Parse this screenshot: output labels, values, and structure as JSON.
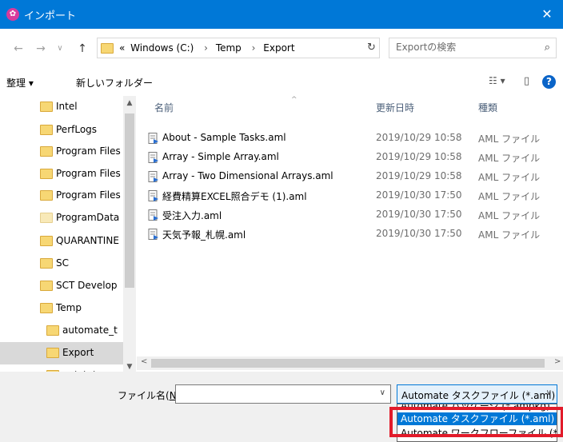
{
  "window": {
    "title": "インポート",
    "close_glyph": "✕"
  },
  "nav_buttons": {
    "back": "←",
    "forward": "→",
    "history": "∨",
    "up": "↑"
  },
  "address": {
    "crumbs": [
      "«",
      "Windows (C:)",
      "›",
      "Temp",
      "›",
      "Export"
    ],
    "dropdown": "∨",
    "refresh": "↻"
  },
  "search": {
    "placeholder": "Exportの検索",
    "icon": "⌕"
  },
  "toolbar": {
    "organize_label": "整理 ▾",
    "new_folder_label": "新しいフォルダー",
    "view_glyph": "☷ ▾",
    "preview_glyph": "▯",
    "help_glyph": "?"
  },
  "nav": {
    "items": [
      {
        "label": "Intel",
        "indent": 1
      },
      {
        "label": "PerfLogs",
        "indent": 1
      },
      {
        "label": "Program Files",
        "indent": 1
      },
      {
        "label": "Program Files",
        "indent": 1
      },
      {
        "label": "Program Files",
        "indent": 1
      },
      {
        "label": "ProgramData",
        "indent": 1
      },
      {
        "label": "QUARANTINE",
        "indent": 1
      },
      {
        "label": "SC",
        "indent": 1
      },
      {
        "label": "SCT Develop",
        "indent": 1
      },
      {
        "label": "Temp",
        "indent": 1
      },
      {
        "label": "automate_t",
        "indent": 2
      },
      {
        "label": "Export",
        "indent": 2
      },
      {
        "label": "getstat",
        "indent": 2
      }
    ],
    "selected_index": 11,
    "scroll_up": "▲",
    "scroll_down": "▼"
  },
  "columns": {
    "name": "名前",
    "modified": "更新日時",
    "type": "種類",
    "sort_caret": "^"
  },
  "files": [
    {
      "name": "About - Sample Tasks.aml",
      "modified": "2019/10/29 10:58",
      "type": "AML ファイル"
    },
    {
      "name": "Array - Simple Array.aml",
      "modified": "2019/10/29 10:58",
      "type": "AML ファイル"
    },
    {
      "name": "Array - Two Dimensional Arrays.aml",
      "modified": "2019/10/29 10:58",
      "type": "AML ファイル"
    },
    {
      "name": "経費精算EXCEL照合デモ (1).aml",
      "modified": "2019/10/30 17:50",
      "type": "AML ファイル"
    },
    {
      "name": "受注入力.aml",
      "modified": "2019/10/30 17:50",
      "type": "AML ファイル"
    },
    {
      "name": "天気予報_札幌.aml",
      "modified": "2019/10/30 17:50",
      "type": "AML ファイル"
    }
  ],
  "hscroll": {
    "left": "<",
    "right": ">"
  },
  "filename": {
    "label_prefix": "ファイル名(",
    "label_key": "N",
    "label_suffix": "):",
    "value": "",
    "dropdown": "∨"
  },
  "filetype": {
    "selected": "Automate タスクファイル (*.aml)",
    "dropdown": "∨",
    "options": [
      "Automate パッケージ (*.ampkg)",
      "Automate タスクファイル (*.aml)",
      "Automate ワークフローファイル (*.amw)"
    ],
    "selected_option_index": 1
  },
  "colors": {
    "titlebar": "#0078d7",
    "selection": "#0078d7",
    "highlight": "#e21b2a",
    "folder": "#f7d774"
  }
}
